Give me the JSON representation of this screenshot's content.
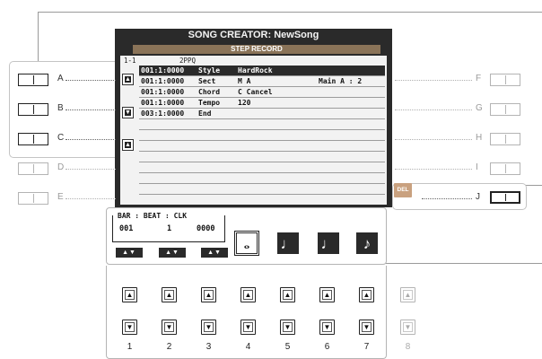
{
  "screen": {
    "title": "SONG CREATOR: NewSong",
    "step_header": "STEP RECORD",
    "track": "1-1",
    "ppq": "2PPQ",
    "rows": [
      {
        "pos": "001:1:0000",
        "event": "Style",
        "value": "HardRock",
        "extra": ""
      },
      {
        "pos": "001:1:0000",
        "event": "Sect",
        "value": "M         A",
        "extra": "Main A  : 2"
      },
      {
        "pos": "001:1:0000",
        "event": "Chord",
        "value": "C       Cancel",
        "extra": ""
      },
      {
        "pos": "001:1:0000",
        "event": "Tempo",
        "value": "        120",
        "extra": ""
      },
      {
        "pos": "003:1:0000",
        "event": "End",
        "value": "",
        "extra": ""
      }
    ],
    "del_label": "DEL"
  },
  "position": {
    "title": "BAR : BEAT : CLK",
    "bar": "001",
    "beat": "1",
    "clk": "0000",
    "updown": "▲▼"
  },
  "note_buttons": [
    {
      "symbol": "𝅝",
      "name": "whole-note"
    },
    {
      "symbol": "♩",
      "name": "half-note"
    },
    {
      "symbol": "♩",
      "name": "quarter-note"
    },
    {
      "symbol": "♪",
      "name": "eighth-note"
    }
  ],
  "panel_left": [
    {
      "label": "A"
    },
    {
      "label": "B"
    },
    {
      "label": "C"
    },
    {
      "label": "D"
    },
    {
      "label": "E"
    }
  ],
  "panel_right": [
    {
      "label": "F"
    },
    {
      "label": "G"
    },
    {
      "label": "H"
    },
    {
      "label": "I"
    },
    {
      "label": "J"
    }
  ],
  "bottom_buttons": {
    "up": "▲",
    "down": "▼",
    "numbers": [
      "1",
      "2",
      "3",
      "4",
      "5",
      "6",
      "7",
      "8"
    ]
  }
}
